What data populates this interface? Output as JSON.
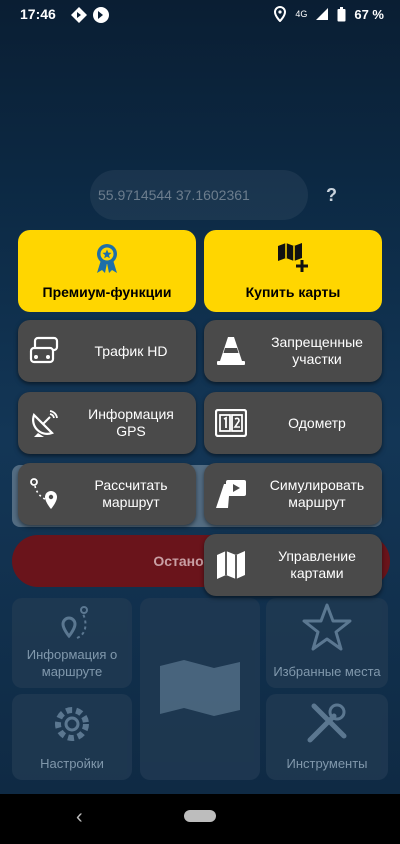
{
  "status_bar": {
    "time": "17:46",
    "network": "4G",
    "battery": "67 %"
  },
  "coords": {
    "value": "55.9714544 37.1602361",
    "help": "?"
  },
  "menu": {
    "premium": "Премиум-функции",
    "buy_maps": "Купить карты",
    "traffic": "Трафик HD",
    "restricted": "Запрещенные участки",
    "gps_info": "Информация GPS",
    "odometer": "Одометр",
    "calc_route": "Рассчитать маршрут",
    "simulate_route": "Симулировать маршрут",
    "manage_maps": "Управление картами"
  },
  "background": {
    "stop_label": "Остановить н",
    "route_info": "Информация о маршруте",
    "favorites": "Избранные места",
    "settings": "Настройки",
    "tools": "Инструменты"
  },
  "colors": {
    "accent_yellow": "#ffd600",
    "menu_gray": "#4a4a4a",
    "stop_red": "#7a0f12"
  }
}
